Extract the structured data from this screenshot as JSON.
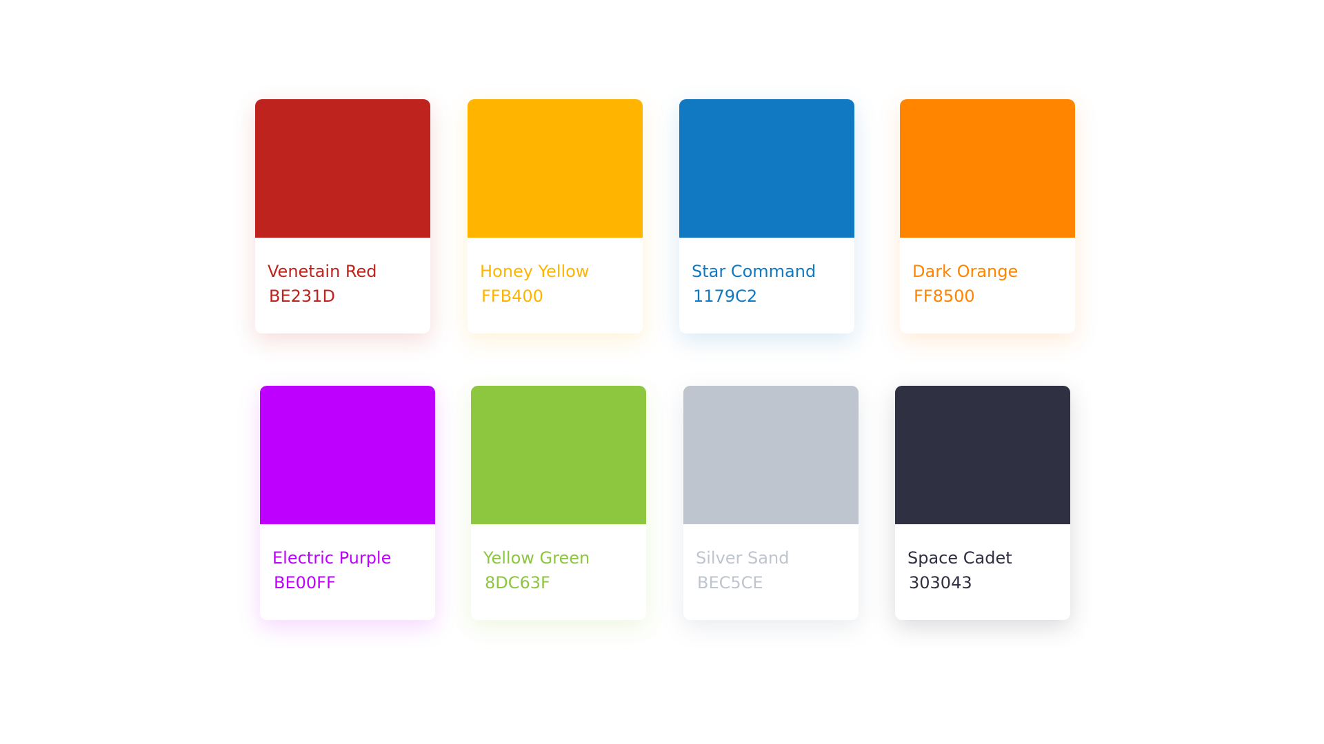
{
  "palette": [
    {
      "name": "Venetain Red",
      "hex": "BE231D",
      "color": "#BE231D",
      "shadow": "rgba(190,35,29,0.16)"
    },
    {
      "name": "Honey Yellow",
      "hex": "FFB400",
      "color": "#FFB400",
      "shadow": "rgba(255,180,0,0.16)"
    },
    {
      "name": "Star Command",
      "hex": "1179C2",
      "color": "#1179C2",
      "shadow": "rgba(17,121,194,0.16)"
    },
    {
      "name": "Dark Orange",
      "hex": "FF8500",
      "color": "#FF8500",
      "shadow": "rgba(255,133,0,0.16)"
    },
    {
      "name": "Electric Purple",
      "hex": "BE00FF",
      "color": "#BE00FF",
      "shadow": "rgba(190,0,255,0.16)"
    },
    {
      "name": "Yellow Green",
      "hex": "8DC63F",
      "color": "#8DC63F",
      "shadow": "rgba(141,198,63,0.16)"
    },
    {
      "name": "Silver Sand",
      "hex": "BEC5CE",
      "color": "#BEC5CE",
      "shadow": "rgba(120,130,150,0.16)"
    },
    {
      "name": "Space Cadet",
      "hex": "303043",
      "color": "#303043",
      "shadow": "rgba(48,48,67,0.18)"
    }
  ]
}
